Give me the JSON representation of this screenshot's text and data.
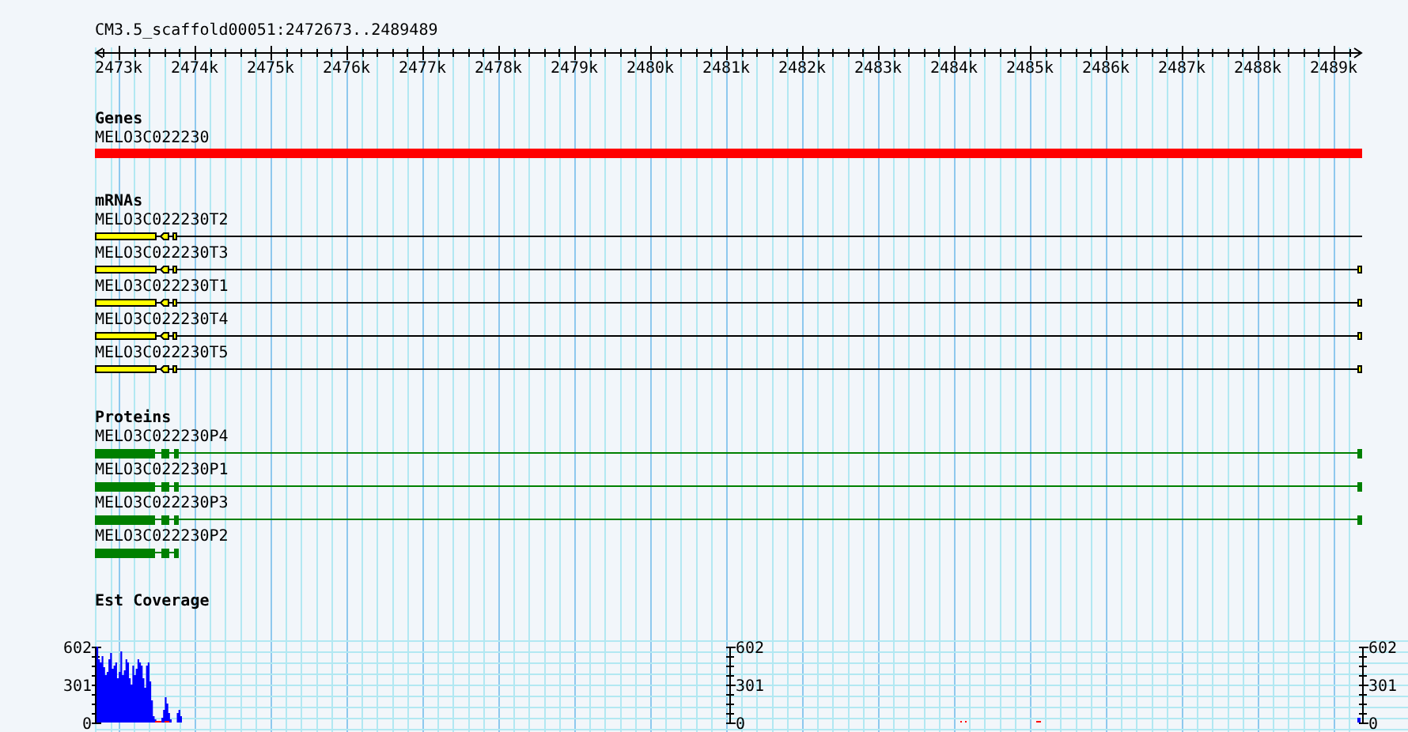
{
  "ruler": {
    "title": "CM3.5_scaffold00051:2472673..2489489",
    "ticks": [
      "2473k",
      "2474k",
      "2475k",
      "2476k",
      "2477k",
      "2478k",
      "2479k",
      "2480k",
      "2481k",
      "2482k",
      "2483k",
      "2484k",
      "2485k",
      "2486k",
      "2487k",
      "2488k",
      "2489k"
    ]
  },
  "genes": {
    "heading": "Genes",
    "items": [
      {
        "name": "MELO3C022230"
      }
    ]
  },
  "mrnas": {
    "heading": "mRNAs",
    "items": [
      {
        "name": "MELO3C022230T2",
        "end_exon": false
      },
      {
        "name": "MELO3C022230T3",
        "end_exon": true
      },
      {
        "name": "MELO3C022230T1",
        "end_exon": true
      },
      {
        "name": "MELO3C022230T4",
        "end_exon": true
      },
      {
        "name": "MELO3C022230T5",
        "end_exon": true
      }
    ]
  },
  "proteins": {
    "heading": "Proteins",
    "items": [
      {
        "name": "MELO3C022230P4",
        "end_exon": true
      },
      {
        "name": "MELO3C022230P1",
        "end_exon": true
      },
      {
        "name": "MELO3C022230P3",
        "end_exon": true
      },
      {
        "name": "MELO3C022230P2",
        "end_exon": false
      }
    ]
  },
  "coverage": {
    "heading": "Est Coverage",
    "axes": [
      {
        "labels": [
          "602",
          "301",
          "0"
        ]
      },
      {
        "labels": [
          "602",
          "301",
          "0"
        ]
      },
      {
        "labels": [
          "602",
          "301",
          "0"
        ]
      }
    ]
  }
}
